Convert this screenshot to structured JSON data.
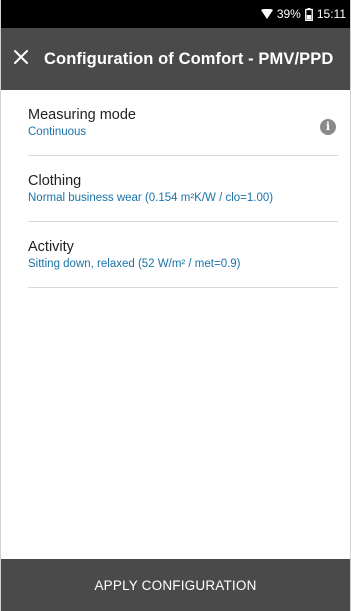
{
  "status_bar": {
    "battery_percent": "39%",
    "time": "15:11",
    "wifi_icon": "wifi-icon",
    "battery_icon": "battery-icon"
  },
  "app_bar": {
    "title": "Configuration of Comfort - PMV/PPD",
    "close_icon": "close-icon"
  },
  "settings": {
    "items": [
      {
        "label": "Measuring mode",
        "value": "Continuous",
        "has_info": true
      },
      {
        "label": "Clothing",
        "value": "Normal business wear (0.154 m²K/W / clo=1.00)",
        "has_info": false
      },
      {
        "label": "Activity",
        "value": "Sitting down, relaxed (52 W/m² / met=0.9)",
        "has_info": false
      }
    ]
  },
  "footer": {
    "apply_label": "APPLY CONFIGURATION"
  },
  "colors": {
    "app_bar": "#4a4a4a",
    "value_text": "#1a73a8",
    "status_bar": "#000000"
  }
}
